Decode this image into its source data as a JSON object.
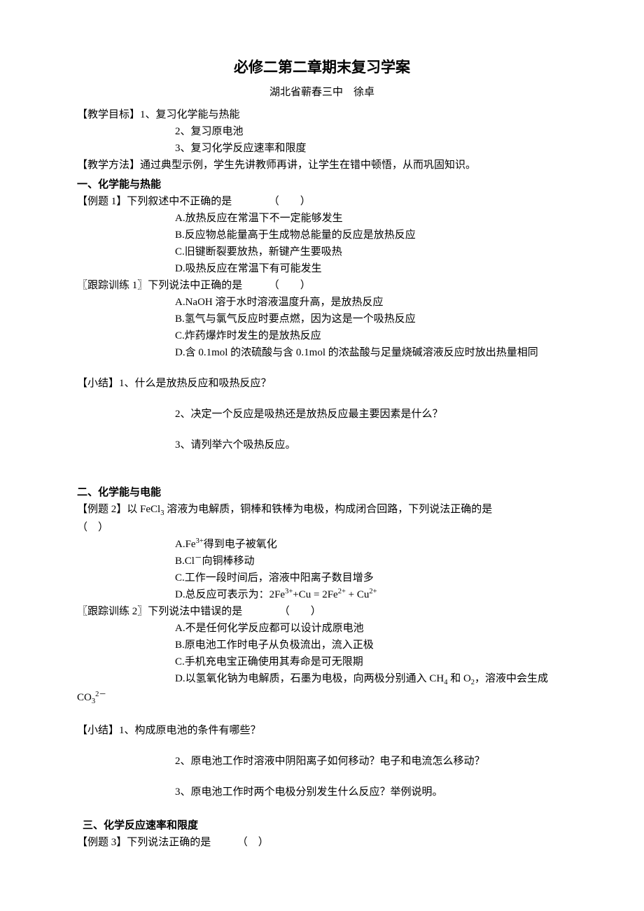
{
  "title": "必修二第二章期末复习学案",
  "author": "湖北省蕲春三中　徐卓",
  "goals": {
    "label": "【教学目标】",
    "items": [
      "1、复习化学能与热能",
      "2、复习原电池",
      "3、复习化学反应速率和限度"
    ]
  },
  "method": {
    "label": "【教学方法】",
    "text": "通过典型示例，学生先讲教师再讲，让学生在错中顿悟，从而巩固知识。"
  },
  "sec1": {
    "head": "一、化学能与热能",
    "ex1": {
      "label": "【例题 1】",
      "stem": "下列叙述中不正确的是　　　　（　　）",
      "opts": [
        "A.放热反应在常温下不一定能够发生",
        "B.反应物总能量高于生成物总能量的反应是放热反应",
        "C.旧键断裂要放热，新键产生要吸热",
        "D.吸热反应在常温下有可能发生"
      ]
    },
    "fu1": {
      "label": "〖跟踪训练 1〗",
      "stem": "下列说法中正确的是　　　（　　）",
      "opts": [
        "A.NaOH 溶于水时溶液温度升高，是放热反应",
        "B.氢气与氯气反应时要点燃，因为这是一个吸热反应",
        "C.炸药爆炸时发生的是放热反应",
        "D.含 0.1mol 的浓硫酸与含 0.1mol 的浓盐酸与足量烧碱溶液反应时放出热量相同"
      ]
    },
    "sum": {
      "label": "【小结】",
      "items": [
        "1、什么是放热反应和吸热反应？",
        "2、决定一个反应是吸热还是放热反应最主要因素是什么？",
        "3、请列举六个吸热反应。"
      ]
    }
  },
  "sec2": {
    "head": "二、化学能与电能",
    "ex2": {
      "label": "【例题 2】",
      "stem_pre": "以 FeCl",
      "stem_post": " 溶液为电解质，铜棒和铁棒为电极，构成闭合回路，下列说法正确的是",
      "stem_line2": "（　）",
      "opts_a_pre": "A.Fe",
      "opts_a_post": "得到电子被氧化",
      "opts_b_pre": "B.Cl",
      "opts_b_post": "向铜棒移动",
      "opts_c": "C.工作一段时间后，溶液中阳离子数目增多",
      "opts_d_pre": "D.总反应可表示为：2Fe",
      "opts_d_mid1": "+Cu = 2Fe",
      "opts_d_mid2": " + Cu"
    },
    "fu2": {
      "label": "〖跟踪训练 2〗",
      "stem": "下列说法中错误的是　　　　（　　）",
      "opts_a": "A.不是任何化学反应都可以设计成原电池",
      "opts_b": "B.原电池工作时电子从负极流出，流入正极",
      "opts_c": "C.手机充电宝正确使用其寿命是可无限期",
      "opts_d_pre": "D.以氢氧化钠为电解质，石墨为电极，向两极分别通入 CH",
      "opts_d_mid": " 和 O",
      "opts_d_post": "，溶液中会生成",
      "opts_d_line2_pre": "CO"
    },
    "sum": {
      "label": "【小结】",
      "items": [
        "1、构成原电池的条件有哪些？",
        "2、原电池工作时溶液中阴阳离子如何移动？电子和电流怎么移动？",
        "3、原电池工作时两个电极分别发生什么反应？举例说明。"
      ]
    }
  },
  "sec3": {
    "head": "三、化学反应速率和限度",
    "ex3": {
      "label": "【例题 3】",
      "stem": "下列说法正确的是　　　（　）"
    }
  }
}
